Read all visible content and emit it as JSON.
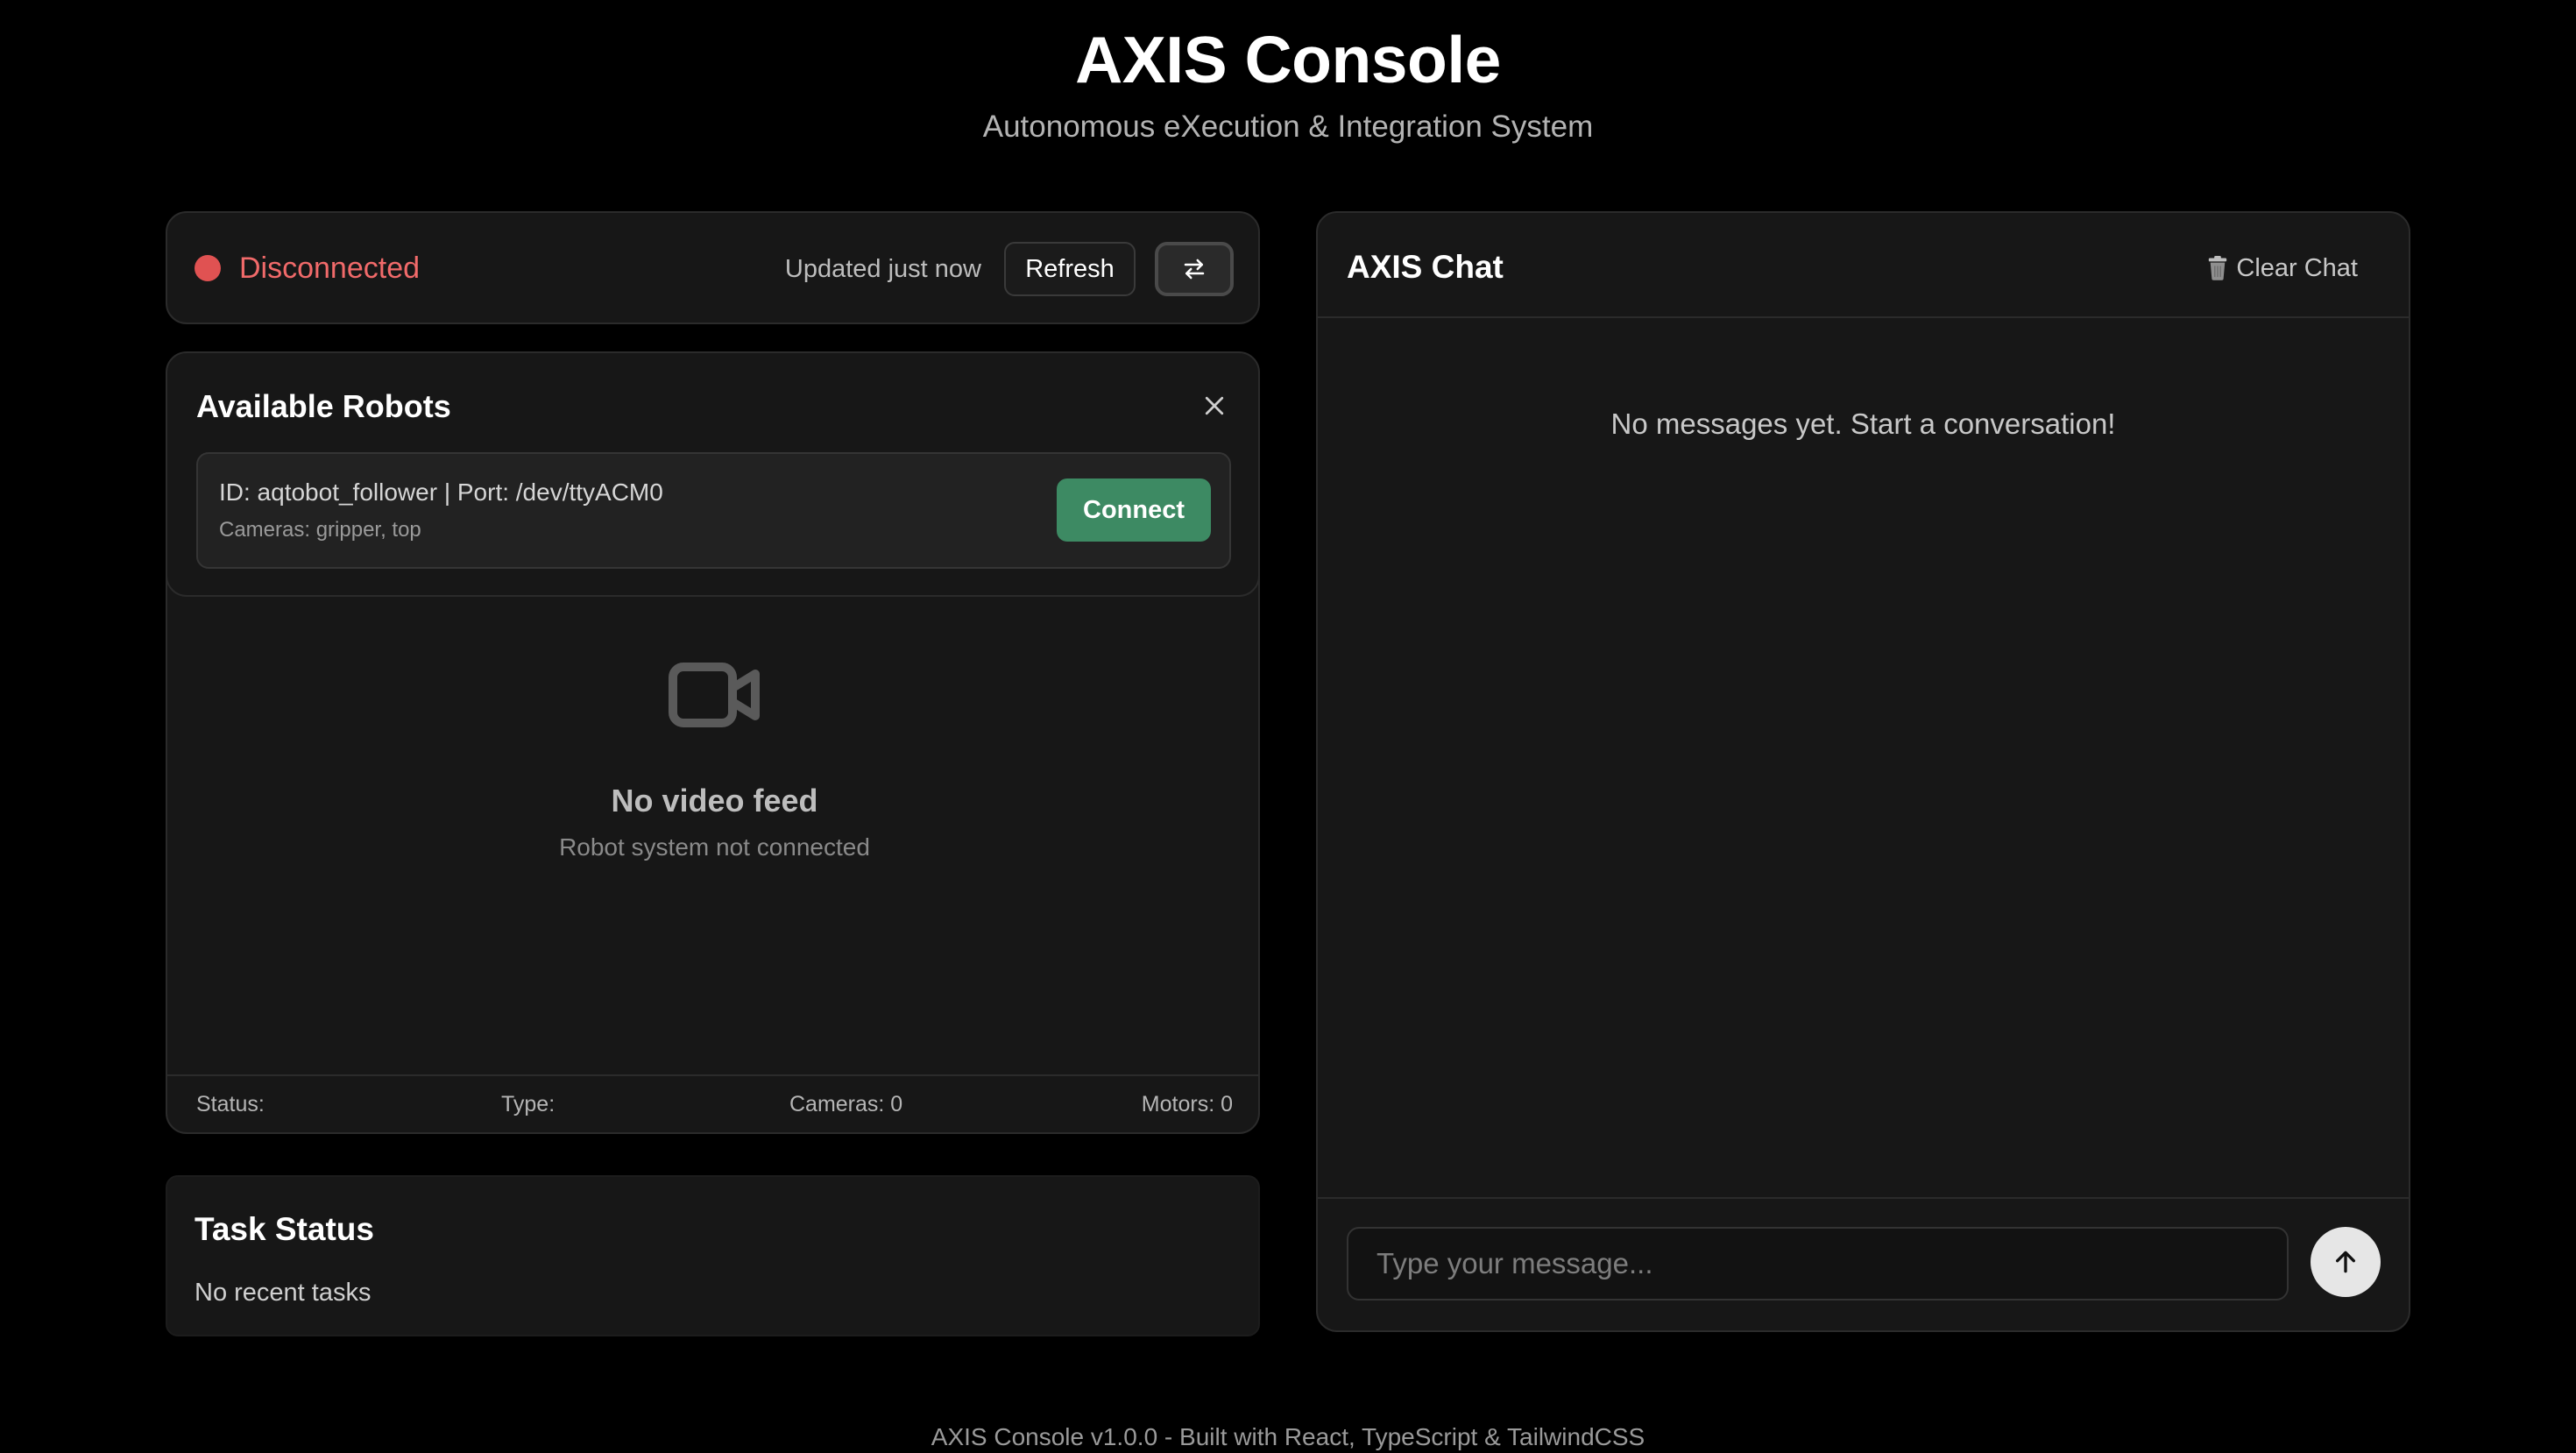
{
  "header": {
    "title": "AXIS Console",
    "subtitle": "Autonomous eXecution & Integration System"
  },
  "connection": {
    "status": "Disconnected",
    "status_color": "#e05252",
    "updated": "Updated just now",
    "refresh_label": "Refresh",
    "switch_icon": "swap-arrows-icon"
  },
  "robots": {
    "title": "Available Robots",
    "close_icon": "close-icon",
    "items": [
      {
        "id_port": "ID: aqtobot_follower | Port: /dev/ttyACM0",
        "cameras": "Cameras: gripper, top",
        "connect_label": "Connect"
      }
    ]
  },
  "video": {
    "icon": "video-camera-icon",
    "title": "No video feed",
    "subtitle": "Robot system not connected"
  },
  "stats": {
    "status": "Status:",
    "type": "Type:",
    "cameras": "Cameras: 0",
    "motors": "Motors: 0"
  },
  "task": {
    "title": "Task Status",
    "empty": "No recent tasks"
  },
  "chat": {
    "title": "AXIS Chat",
    "clear_icon": "trash-icon",
    "clear_label": "Clear Chat",
    "empty": "No messages yet. Start a conversation!",
    "input_placeholder": "Type your message...",
    "send_icon": "arrow-up-icon"
  },
  "footer": {
    "text": "AXIS Console v1.0.0 - Built with React, TypeScript & TailwindCSS"
  },
  "colors": {
    "background": "#000000",
    "card": "#171717",
    "accent_green": "#3d8a63",
    "error_red": "#f16a6a"
  }
}
